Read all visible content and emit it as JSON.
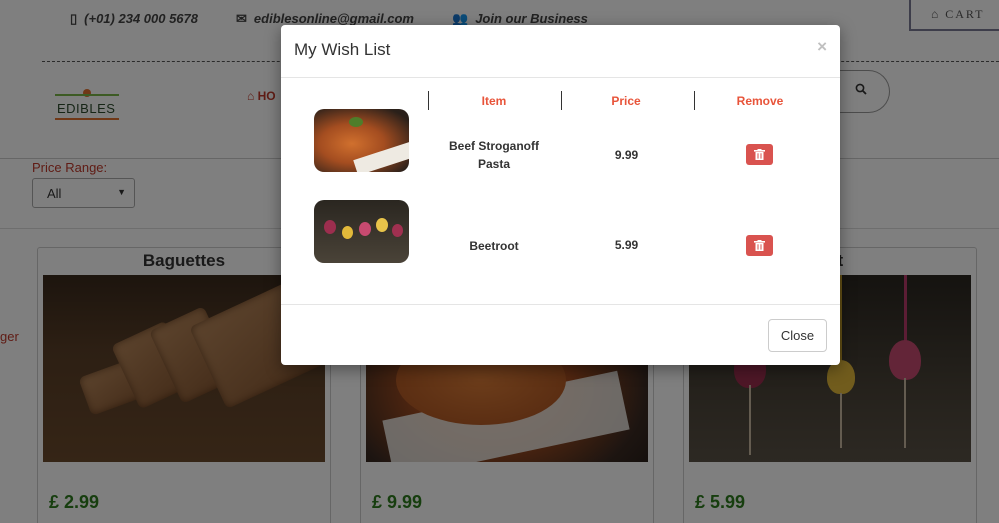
{
  "topbar": {
    "phone": "(+01) 234 000 5678",
    "email": "ediblesonline@gmail.com",
    "join": "Join our Business",
    "cart_label": "CART"
  },
  "header": {
    "logo_text": "EDIBLES",
    "nav_home": "HO"
  },
  "filters": {
    "price_range_label": "Price Range:",
    "price_range_value": "All"
  },
  "sidebar": {
    "partial_text": "ger"
  },
  "products": [
    {
      "title": "Baguettes",
      "price": "£ 2.99"
    },
    {
      "title": "",
      "price": "£ 9.99"
    },
    {
      "title": "oot",
      "price": "£ 5.99"
    }
  ],
  "modal": {
    "title": "My Wish List",
    "close_symbol": "×",
    "columns": {
      "item": "Item",
      "price": "Price",
      "remove": "Remove"
    },
    "rows": [
      {
        "name": "Beef Stroganoff Pasta",
        "price": "9.99"
      },
      {
        "name": "Beetroot",
        "price": "5.99"
      }
    ],
    "close_button": "Close"
  },
  "colors": {
    "accent_red": "#e8543a",
    "price_green": "#2e7d1f",
    "danger": "#d9534f"
  }
}
